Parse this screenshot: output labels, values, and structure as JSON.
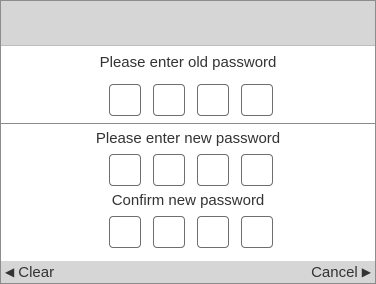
{
  "old_password": {
    "prompt": "Please enter old password",
    "digit_count": 4
  },
  "new_password": {
    "prompt": "Please enter new password",
    "digit_count": 4
  },
  "confirm_password": {
    "prompt": "Confirm new password",
    "digit_count": 4
  },
  "softkeys": {
    "left_label": "Clear",
    "left_icon": "left-triangle-icon",
    "right_label": "Cancel",
    "right_icon": "right-triangle-icon"
  },
  "colors": {
    "bar_background": "#d6d6d6",
    "text": "#333333",
    "box_border": "#6e6e6e"
  }
}
